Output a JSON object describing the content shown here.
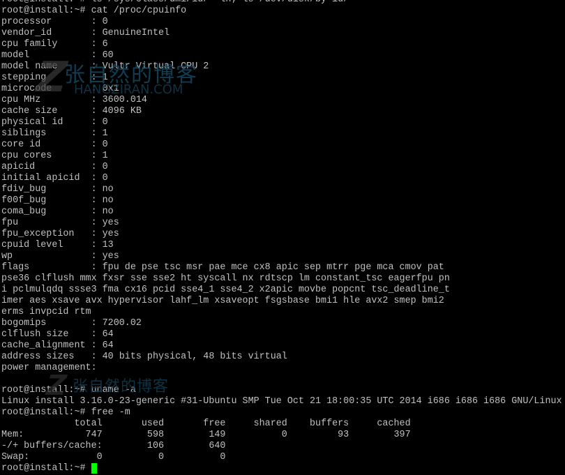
{
  "terminal": {
    "lines": [
      "root@install:~# ls /sys/class/dmi/id/ -lh; ls /dev/disk/by-id/",
      "root@install:~# cat /proc/cpuinfo",
      "processor       : 0",
      "vendor_id       : GenuineIntel",
      "cpu family      : 6",
      "model           : 60",
      "model name      : Vultr Virtual CPU 2",
      "stepping        : 1",
      "microcode       : 0x1",
      "cpu MHz         : 3600.014",
      "cache size      : 4096 KB",
      "physical id     : 0",
      "siblings        : 1",
      "core id         : 0",
      "cpu cores       : 1",
      "apicid          : 0",
      "initial apicid  : 0",
      "fdiv_bug        : no",
      "f00f_bug        : no",
      "coma_bug        : no",
      "fpu             : yes",
      "fpu_exception   : yes",
      "cpuid level     : 13",
      "wp              : yes",
      "flags           : fpu de pse tsc msr pae mce cx8 apic sep mtrr pge mca cmov pat",
      "pse36 clflush mmx fxsr sse sse2 ht syscall nx rdtscp lm constant_tsc eagerfpu pn",
      "i pclmulqdq ssse3 fma cx16 pcid sse4_1 sse4_2 x2apic movbe popcnt tsc_deadline_t",
      "imer aes xsave avx hypervisor lahf_lm xsaveopt fsgsbase bmi1 hle avx2 smep bmi2",
      "erms invpcid rtm",
      "bogomips        : 7200.02",
      "clflush size    : 64",
      "cache_alignment : 64",
      "address sizes   : 40 bits physical, 48 bits virtual",
      "power management:",
      "",
      "root@install:~# uname -a",
      "Linux install 3.16.0-23-generic #31-Ubuntu SMP Tue Oct 21 18:00:35 UTC 2014 i686 i686 i686 GNU/Linux",
      "root@install:~# free -m",
      "             total       used       free     shared    buffers     cached",
      "Mem:           747        598        149          0         93        397",
      "-/+ buffers/cache:        106        640",
      "Swap:            0          0          0"
    ],
    "prompt": "root@install:~# ",
    "cursor_color": "#00ff00",
    "text_color": "#c0c0c0",
    "background_color": "#000000"
  },
  "watermark": {
    "title": "张自然的博客",
    "subtitle": "HANGZIRAN.COM",
    "logo_letter": "Z"
  }
}
